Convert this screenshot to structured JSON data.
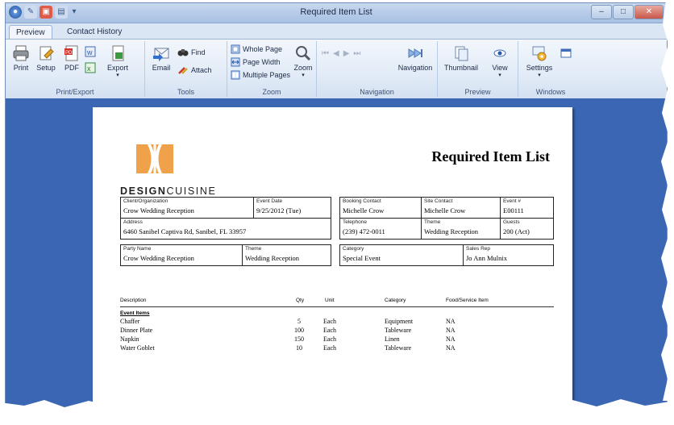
{
  "window": {
    "title": "Required Item List",
    "controls": {
      "minimize": "–",
      "maximize": "□",
      "close": "✕"
    }
  },
  "ribbon": {
    "tabs": [
      {
        "label": "Preview",
        "active": true
      },
      {
        "label": "Contact History",
        "active": false
      }
    ],
    "groups": {
      "print_export": {
        "label": "Print/Export",
        "print": "Print",
        "setup": "Setup",
        "pdf": "PDF",
        "export": "Export"
      },
      "tools": {
        "label": "Tools",
        "email": "Email",
        "find": "Find",
        "attach": "Attach"
      },
      "zoom": {
        "label": "Zoom",
        "whole_page": "Whole Page",
        "page_width": "Page Width",
        "multiple_pages": "Multiple Pages",
        "zoom": "Zoom"
      },
      "navigation": {
        "label": "Navigation",
        "navigation": "Navigation"
      },
      "preview": {
        "label": "Preview",
        "thumbnail": "Thumbnail",
        "view": "View"
      },
      "windows": {
        "label": "Windows",
        "settings": "Settings"
      }
    }
  },
  "report": {
    "title": "Required Item List",
    "brand_bold": "DESIGN",
    "brand_rest": "CUISINE",
    "fields": {
      "client_label": "Client/Organization",
      "client": "Crow Wedding Reception",
      "event_date_label": "Event Date",
      "event_date": "9/25/2012 (Tue)",
      "address_label": "Address",
      "address": "6460 Sanibel Captiva Rd, Sanibel, FL 33957",
      "booking_contact_label": "Booking Contact",
      "booking_contact": "Michelle Crow",
      "site_contact_label": "Site Contact",
      "site_contact": "Michelle Crow",
      "event_no_label": "Event #",
      "event_no": "E00111",
      "telephone_label": "Telephone",
      "telephone": "(239) 472-0011",
      "theme_label": "Theme",
      "theme": "Wedding Reception",
      "guests_label": "Guests",
      "guests": "200 (Act)",
      "party_name_label": "Party Name",
      "party_name": "Crow Wedding Reception",
      "party_theme_label": "Theme",
      "party_theme": "Wedding Reception",
      "category_label": "Category",
      "category": "Special Event",
      "sales_rep_label": "Sales Rep",
      "sales_rep": "Jo Ann Mulnix"
    },
    "columns": {
      "description": "Description",
      "qty": "Qty",
      "unit": "Unit",
      "category": "Category",
      "food_service": "Food/Service Item"
    },
    "section": "Event Items",
    "items": [
      {
        "description": "Chaffer",
        "qty": "5",
        "unit": "Each",
        "category": "Equipment",
        "food": "NA"
      },
      {
        "description": "Dinner Plate",
        "qty": "100",
        "unit": "Each",
        "category": "Tableware",
        "food": "NA"
      },
      {
        "description": "Napkin",
        "qty": "150",
        "unit": "Each",
        "category": "Linen",
        "food": "NA"
      },
      {
        "description": "Water Goblet",
        "qty": "10",
        "unit": "Each",
        "category": "Tableware",
        "food": "NA"
      }
    ]
  }
}
